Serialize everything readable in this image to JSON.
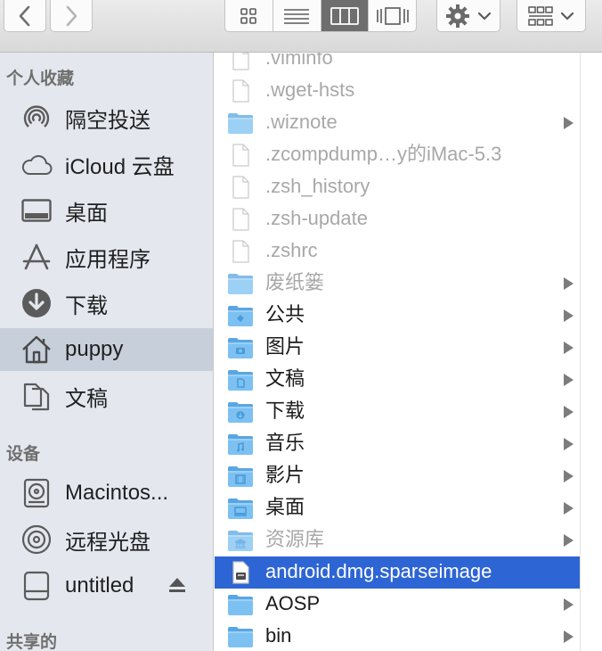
{
  "sidebar": {
    "favorites_title": "个人收藏",
    "devices_title": "设备",
    "shared_title": "共享的",
    "favorites": [
      {
        "label": "隔空投送",
        "icon": "airdrop-icon"
      },
      {
        "label": "iCloud 云盘",
        "icon": "cloud-icon"
      },
      {
        "label": "桌面",
        "icon": "desktop-icon"
      },
      {
        "label": "应用程序",
        "icon": "applications-icon"
      },
      {
        "label": "下载",
        "icon": "download-icon"
      },
      {
        "label": "puppy",
        "icon": "home-icon"
      },
      {
        "label": "文稿",
        "icon": "documents-icon"
      }
    ],
    "devices": [
      {
        "label": "Macintos...",
        "icon": "harddisk-icon"
      },
      {
        "label": "远程光盘",
        "icon": "optical-disc-icon"
      },
      {
        "label": "untitled",
        "icon": "external-drive-icon"
      }
    ]
  },
  "files": [
    {
      "name": ".viminfo",
      "kind": "file",
      "dim": true
    },
    {
      "name": ".wget-hsts",
      "kind": "file",
      "dim": true
    },
    {
      "name": ".wiznote",
      "kind": "folder",
      "dim": true
    },
    {
      "name": ".zcompdump…y的iMac-5.3",
      "kind": "file",
      "dim": true
    },
    {
      "name": ".zsh_history",
      "kind": "file",
      "dim": true
    },
    {
      "name": ".zsh-update",
      "kind": "file",
      "dim": true
    },
    {
      "name": ".zshrc",
      "kind": "file",
      "dim": true
    },
    {
      "name": "废纸篓",
      "kind": "folder",
      "dim": true
    },
    {
      "name": "公共",
      "kind": "folder-public",
      "dim": false
    },
    {
      "name": "图片",
      "kind": "folder-pictures",
      "dim": false
    },
    {
      "name": "文稿",
      "kind": "folder-documents",
      "dim": false
    },
    {
      "name": "下载",
      "kind": "folder-downloads",
      "dim": false
    },
    {
      "name": "音乐",
      "kind": "folder-music",
      "dim": false
    },
    {
      "name": "影片",
      "kind": "folder-movies",
      "dim": false
    },
    {
      "name": "桌面",
      "kind": "folder-desktop",
      "dim": false
    },
    {
      "name": "资源库",
      "kind": "folder-library",
      "dim": true
    },
    {
      "name": "android.dmg.sparseimage",
      "kind": "disk-image",
      "dim": false,
      "selected": true
    },
    {
      "name": "AOSP",
      "kind": "folder",
      "dim": false
    },
    {
      "name": "bin",
      "kind": "folder",
      "dim": false
    }
  ],
  "colors": {
    "selection": "#2d65d4",
    "sidebar_selection": "#c7cfdb",
    "sidebar_bg": "#e4e8ee",
    "folder": "#6cb7ef"
  }
}
